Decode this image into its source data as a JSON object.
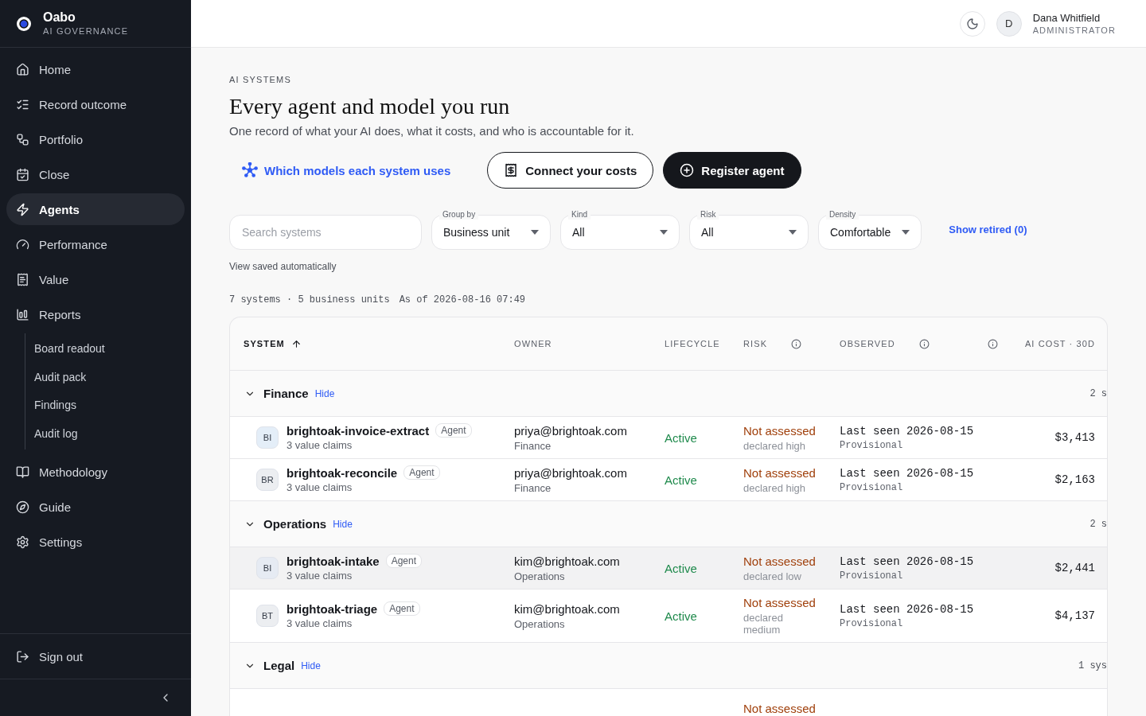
{
  "brand": {
    "name": "Oabo",
    "tagline": "AI GOVERNANCE"
  },
  "sidebar": {
    "items": [
      {
        "label": "Home",
        "selected": false
      },
      {
        "label": "Record outcome",
        "selected": false
      },
      {
        "label": "Portfolio",
        "selected": false
      },
      {
        "label": "Close",
        "selected": false
      },
      {
        "label": "Agents",
        "selected": true
      },
      {
        "label": "Performance",
        "selected": false
      },
      {
        "label": "Value",
        "selected": false
      },
      {
        "label": "Reports",
        "selected": false,
        "children": [
          {
            "label": "Board readout",
            "selected": false
          },
          {
            "label": "Audit pack",
            "selected": false
          },
          {
            "label": "Findings",
            "selected": false
          },
          {
            "label": "Audit log",
            "selected": false
          }
        ]
      },
      {
        "label": "Methodology",
        "selected": false
      },
      {
        "label": "Guide",
        "selected": false
      },
      {
        "label": "Settings",
        "selected": false
      }
    ],
    "footer": {
      "label": "Sign out"
    }
  },
  "topbar": {
    "user": {
      "initial": "D",
      "name": "Dana Whitfield",
      "role": "ADMINISTRATOR"
    }
  },
  "page": {
    "eyebrow": "AI SYSTEMS",
    "title": "Every agent and model you run",
    "subtitle": "One record of what your AI does, what it costs, and who is accountable for it."
  },
  "actions": [
    {
      "kind": "link",
      "label": "Which models each system uses"
    },
    {
      "kind": "outline",
      "label": "Connect your costs"
    },
    {
      "kind": "primary",
      "label": "Register agent"
    }
  ],
  "filters": {
    "search": {
      "placeholder": "Search systems"
    },
    "selects": [
      {
        "label": "Group by",
        "value": "Business unit"
      },
      {
        "label": "Kind",
        "value": "All"
      },
      {
        "label": "Risk",
        "value": "All"
      },
      {
        "label": "Density",
        "value": "Comfortable"
      }
    ],
    "retired_link": "Show retired (0)",
    "note": "View saved automatically"
  },
  "summary": {
    "counts": "7 systems · 5 business units",
    "as_of": "As of 2026-08-16 07:49"
  },
  "table": {
    "columns": [
      {
        "label": "SYSTEM",
        "sorted": true,
        "info": false
      },
      {
        "label": "OWNER",
        "info": false
      },
      {
        "label": "LIFECYCLE",
        "info": false
      },
      {
        "label": "RISK",
        "info": true
      },
      {
        "label": "OBSERVED",
        "info": true
      },
      {
        "info": true
      },
      {
        "label": "AI COST · 30D",
        "info": false
      }
    ],
    "groups": [
      {
        "name": "Finance",
        "action": "Hide",
        "count": "2 s",
        "expanded": true,
        "rows": [
          {
            "initials": "BI",
            "color": "#e4eef8",
            "name": "brightoak-invoice-extract",
            "badge": "Agent",
            "claims": "3 value claims",
            "owner": "priya@brightoak.com",
            "unit": "Finance",
            "lifecycle": "Active",
            "risk": "Not assessed",
            "risk_note": "declared high",
            "observed": "Last seen 2026-08-15",
            "observed_note": "Provisional",
            "cost": "$3,413",
            "hovered": false
          },
          {
            "initials": "BR",
            "color": "#eceef1",
            "name": "brightoak-reconcile",
            "badge": "Agent",
            "claims": "3 value claims",
            "owner": "priya@brightoak.com",
            "unit": "Finance",
            "lifecycle": "Active",
            "risk": "Not assessed",
            "risk_note": "declared high",
            "observed": "Last seen 2026-08-15",
            "observed_note": "Provisional",
            "cost": "$2,163",
            "hovered": false
          }
        ]
      },
      {
        "name": "Operations",
        "action": "Hide",
        "count": "2 s",
        "expanded": true,
        "rows": [
          {
            "initials": "BI",
            "color": "#e6ebf3",
            "name": "brightoak-intake",
            "badge": "Agent",
            "claims": "3 value claims",
            "owner": "kim@brightoak.com",
            "unit": "Operations",
            "lifecycle": "Active",
            "risk": "Not assessed",
            "risk_note": "declared low",
            "observed": "Last seen 2026-08-15",
            "observed_note": "Provisional",
            "cost": "$2,441",
            "hovered": true
          },
          {
            "initials": "BT",
            "color": "#eceef1",
            "name": "brightoak-triage",
            "badge": "Agent",
            "claims": "3 value claims",
            "owner": "kim@brightoak.com",
            "unit": "Operations",
            "lifecycle": "Active",
            "risk": "Not assessed",
            "risk_note": "declared medium",
            "observed": "Last seen 2026-08-15",
            "observed_note": "Provisional",
            "cost": "$4,137",
            "hovered": false
          }
        ]
      },
      {
        "name": "Legal",
        "action": "Hide",
        "count": "1 sys",
        "expanded": true,
        "rows": [
          {
            "risk": "Not assessed",
            "hovered": false
          }
        ]
      }
    ]
  }
}
